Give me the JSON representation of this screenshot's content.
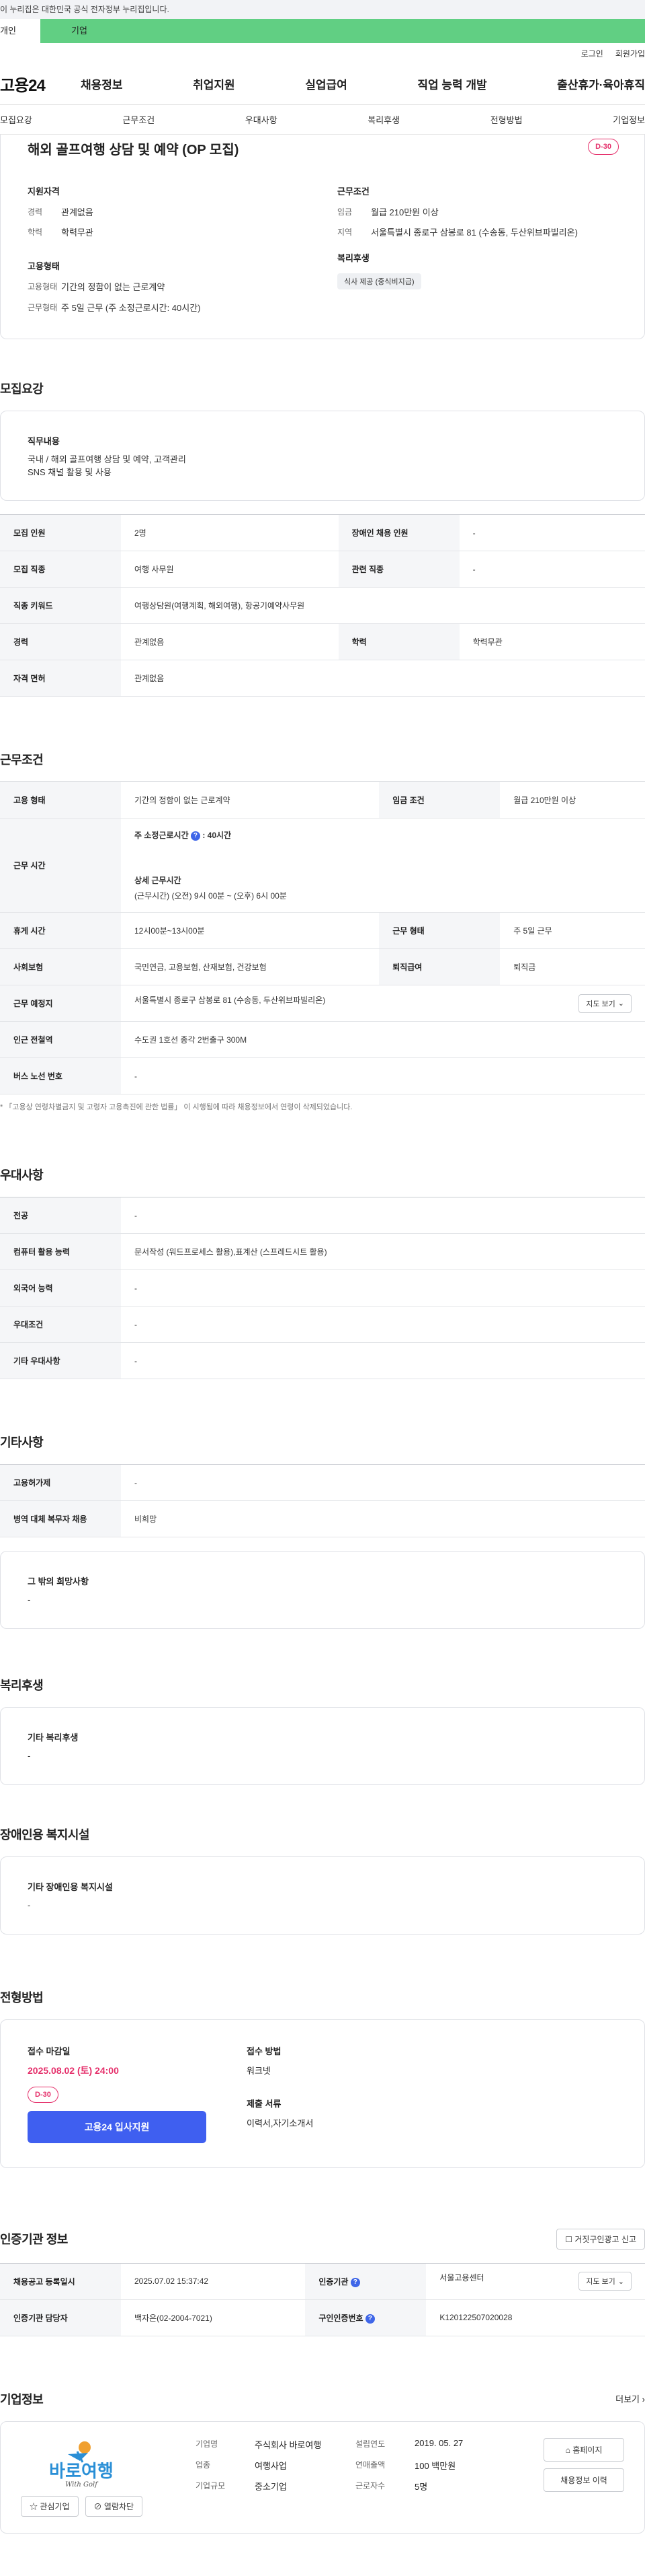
{
  "banner": "이 누리집은 대한민국 공식 전자정부 누리집입니다.",
  "tabs": {
    "a": "개인",
    "b": "기업"
  },
  "util": {
    "login": "로그인",
    "signup": "회원가입"
  },
  "logo": "고용24",
  "gnb": [
    "채용정보",
    "취업지원",
    "실업급여",
    "직업 능력 개발",
    "출산휴가·육아휴직"
  ],
  "subnav": [
    "모집요강",
    "근무조건",
    "우대사항",
    "복리후생",
    "전형방법",
    "기업정보"
  ],
  "top": {
    "title": "해외 골프여행 상담 및 예약 (OP 모집)",
    "dday": "D-30",
    "qual_h": "지원자격",
    "qual": [
      {
        "k": "경력",
        "v": "관계없음"
      },
      {
        "k": "학력",
        "v": "학력무관"
      }
    ],
    "emp_h": "고용형태",
    "emp": [
      {
        "k": "고용형태",
        "v": "기간의 정함이 없는 근로계약"
      },
      {
        "k": "근무형태",
        "v": "주 5일 근무 (주 소정근로시간: 40시간)"
      }
    ],
    "work_h": "근무조건",
    "work": [
      {
        "k": "임금",
        "v": "월급 210만원 이상"
      },
      {
        "k": "지역",
        "v": "서울특별시 종로구 삼봉로 81 (수송동, 두산위브파빌리온)"
      }
    ],
    "welfare_h": "복리후생",
    "welfare_pill": "식사 제공 (중식비지급)"
  },
  "recruit": {
    "title": "모집요강",
    "duty_h": "직무내용",
    "duty_lines": [
      "국내 / 해외 골프여행 상담 및 예약,  고객관리",
      "SNS 채널 활용 및 사용"
    ],
    "rows": [
      {
        "k1": "모집 인원",
        "v1": "2명",
        "k2": "장애인 채용 인원",
        "v2": "-"
      },
      {
        "k1": "모집 직종",
        "v1": "여행 사무원",
        "k2": "관련 직종",
        "v2": "-"
      },
      {
        "k1": "직종 키워드",
        "v1": "여행상담원(여행계획, 해외여행), 항공기예약사무원"
      },
      {
        "k1": "경력",
        "v1": "관계없음",
        "k2": "학력",
        "v2": "학력무관"
      },
      {
        "k1": "자격 면허",
        "v1": "관계없음"
      }
    ]
  },
  "workcond": {
    "title": "근무조건",
    "emp_type_k": "고용 형태",
    "emp_type_v": "기간의 정함이 없는 근로계약",
    "wage_k": "임금 조건",
    "wage_v": "월급 210만원 이상",
    "hours_k": "근무 시간",
    "hours_a": "주 소정근로시간",
    "hours_a_v": ": 40시간",
    "hours_b": "상세 근무시간",
    "hours_b_v": "(근무시간) (오전) 9시 00분 ~ (오후) 6시 00분",
    "break_k": "휴게 시간",
    "break_v": "12시00분~13시00분",
    "form_k": "근무 형태",
    "form_v": "주 5일 근무",
    "ins_k": "사회보험",
    "ins_v": "국민연금, 고용보험, 산재보험, 건강보험",
    "sev_k": "퇴직급여",
    "sev_v": "퇴직금",
    "place_k": "근무 예정지",
    "place_v": "서울특별시 종로구 삼봉로 81 (수송동, 두산위브파빌리온)",
    "map_btn": "지도 보기",
    "subway_k": "인근 전철역",
    "subway_v": "수도권 1호선 종각 2번출구 300M",
    "bus_k": "버스 노선 번호",
    "bus_v": "-",
    "note": "* 「고용상 연령차별금지 및 고령자 고용촉진에 관한 법률」 이 시행됨에 따라 채용정보에서 연령이 삭제되었습니다."
  },
  "prefer": {
    "title": "우대사항",
    "rows": [
      {
        "k": "전공",
        "v": "-"
      },
      {
        "k": "컴퓨터 활용 능력",
        "v": "문서작성 (워드프로세스 활용),표계산 (스프레드시트 활용)"
      },
      {
        "k": "외국어 능력",
        "v": "-"
      },
      {
        "k": "우대조건",
        "v": "-"
      },
      {
        "k": "기타 우대사항",
        "v": "-"
      }
    ]
  },
  "etc": {
    "title": "기타사항",
    "rows": [
      {
        "k": "고용허가제",
        "v": "-"
      },
      {
        "k": "병역 대체 복무자 채용",
        "v": "비희망"
      }
    ],
    "other_h": "그 밖의 희망사항",
    "other_v": "-"
  },
  "welfare": {
    "title": "복리후생",
    "h": "기타 복리후생",
    "v": "-"
  },
  "disabled": {
    "title": "장애인용 복지시설",
    "h": "기타 장애인용 복지시설",
    "v": "-"
  },
  "process": {
    "title": "전형방법",
    "deadline_h": "접수 마감일",
    "deadline_v": "2025.08.02 (토) 24:00",
    "dday": "D-30",
    "apply_btn": "고용24 입사지원",
    "method_h": "접수 방법",
    "method_v": "워크넷",
    "docs_h": "제출 서류",
    "docs_v": "이력서,자기소개서"
  },
  "agency": {
    "title": "인증기관 정보",
    "report_btn": "거짓구인광고 신고",
    "reg_k": "채용공고 등록일시",
    "reg_v": "2025.07.02 15:37:42",
    "org_k": "인증기관",
    "org_v": "서울고용센터",
    "map_btn": "지도 보기",
    "mgr_k": "인증기관 담당자",
    "mgr_v": "백자은(02-2004-7021)",
    "no_k": "구인인증번호",
    "no_v": "K120122507020028"
  },
  "company": {
    "title": "기업정보",
    "more": "더보기",
    "logo_text": "바로여행",
    "logo_sub": "With Golf",
    "fav_btn": "관심기업",
    "block_btn": "열람차단",
    "name_k": "기업명",
    "name_v": "주식회사 바로여행",
    "ind_k": "업종",
    "ind_v": "여행사업",
    "size_k": "기업규모",
    "size_v": "중소기업",
    "est_k": "설립연도",
    "est_v": "2019. 05. 27",
    "sales_k": "연매출액",
    "sales_v": "100 백만원",
    "emp_k": "근로자수",
    "emp_v": "5명",
    "home_btn": "홈페이지",
    "jobs_btn": "채용정보 이력"
  }
}
